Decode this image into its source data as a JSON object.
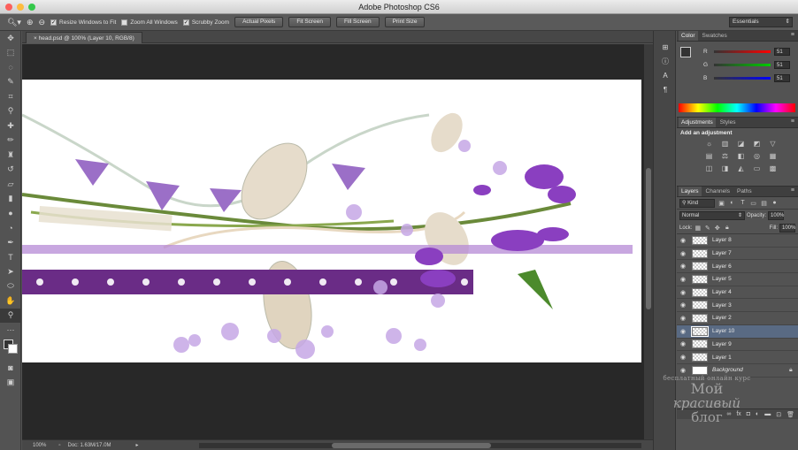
{
  "window": {
    "title": "Adobe Photoshop CS6"
  },
  "options": {
    "resize_windows_label": "Resize Windows to Fit",
    "zoom_all_label": "Zoom All Windows",
    "scrubby_label": "Scrubby Zoom",
    "actual_pixels": "Actual Pixels",
    "fit_screen": "Fit Screen",
    "fill_screen": "Fill Screen",
    "print_size": "Print Size",
    "workspace": "Essentials"
  },
  "document": {
    "tab": "head.psd @ 100% (Layer 10, RGB/8)"
  },
  "status": {
    "zoom": "100%",
    "doc": "Doc: 1.63M/17.0M"
  },
  "color_panel": {
    "tabs": [
      "Color",
      "Swatches"
    ],
    "r": "51",
    "g": "51",
    "b": "51",
    "r_label": "R",
    "g_label": "G",
    "b_label": "B"
  },
  "adjustments": {
    "tabs": [
      "Adjustments",
      "Styles"
    ],
    "add_label": "Add an adjustment"
  },
  "layers_panel": {
    "tabs": [
      "Layers",
      "Channels",
      "Paths"
    ],
    "kind": "Kind",
    "blend": "Normal",
    "opacity_label": "Opacity:",
    "opacity": "100%",
    "lock_label": "Lock:",
    "fill_label": "Fill:",
    "fill": "100%",
    "layers": [
      {
        "name": "Layer 8"
      },
      {
        "name": "Layer 7"
      },
      {
        "name": "Layer 6"
      },
      {
        "name": "Layer 5"
      },
      {
        "name": "Layer 4"
      },
      {
        "name": "Layer 3"
      },
      {
        "name": "Layer 2"
      },
      {
        "name": "Layer 10"
      },
      {
        "name": "Layer 9"
      },
      {
        "name": "Layer 1"
      },
      {
        "name": "Background"
      }
    ]
  },
  "watermark": {
    "line1": "бесплатный онлайн курс",
    "line2": "Мой",
    "line3": "красивый",
    "line4": "блог"
  },
  "colors": {
    "selected_layer": "#596a83",
    "lavender": "#9b6fc7",
    "lace": "#6a2c86"
  }
}
